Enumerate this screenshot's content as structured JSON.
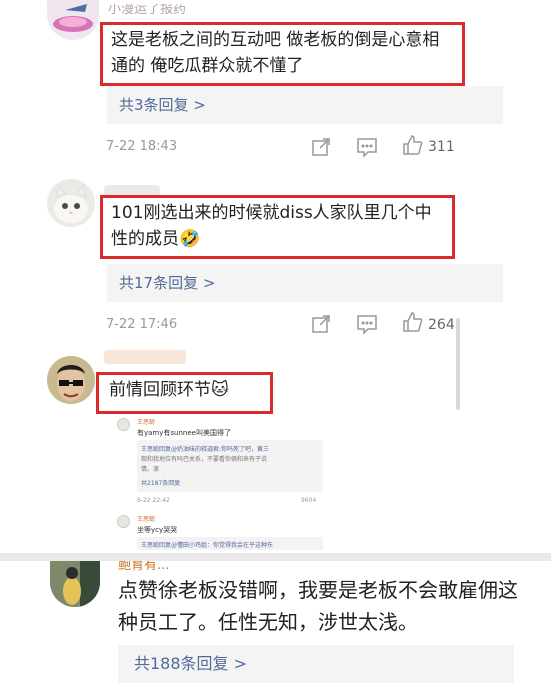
{
  "comments": [
    {
      "username": "小漫运了报药",
      "text": "这是老板之间的互动吧 做老板的倒是心意相通的 俺吃瓜群众就不懂了",
      "replies_label": "共3条回复 >",
      "time": "7-22 18:43",
      "likes": "311"
    },
    {
      "text": "101刚选出来的时候就diss人家队里几个中性的成员",
      "emoji": "🤣",
      "replies_label": "共17条回复 >",
      "time": "7-22 17:46",
      "likes": "264"
    },
    {
      "text": "前情回顾环节",
      "emoji": "🐱"
    }
  ],
  "nested_screenshot": {
    "user1": "王思聪",
    "line1": "有yamy有sunnee叫美国得了",
    "quote1_line1": "王思聪回复@奶油味的释迦君:你吗死了吧，黄三",
    "quote1_line2": "观和我地位有吗巴关系，不要看你俩和来有子说",
    "quote1_line3": "情。滚",
    "quote1_replies": "共2187条回复",
    "time1": "6-22 22:42",
    "likes1": "9604",
    "user2": "王思聪",
    "line2": "坐等ycy哭哭",
    "quote2": "王思聪回复@懂田小鸡姐：你觉得我会在乎这种东"
  },
  "bottom_comment": {
    "username": "鲍育有...",
    "text": "点赞徐老板没错啊，我要是老板不会敢雇佣这种员工了。任性无知，涉世太浅。",
    "replies_label": "共188条回复 >"
  },
  "colors": {
    "highlight": "#d92b2b",
    "link": "#526a99",
    "meta": "#999999"
  },
  "icons": [
    "share-icon",
    "comment-icon",
    "thumbs-up-icon"
  ]
}
